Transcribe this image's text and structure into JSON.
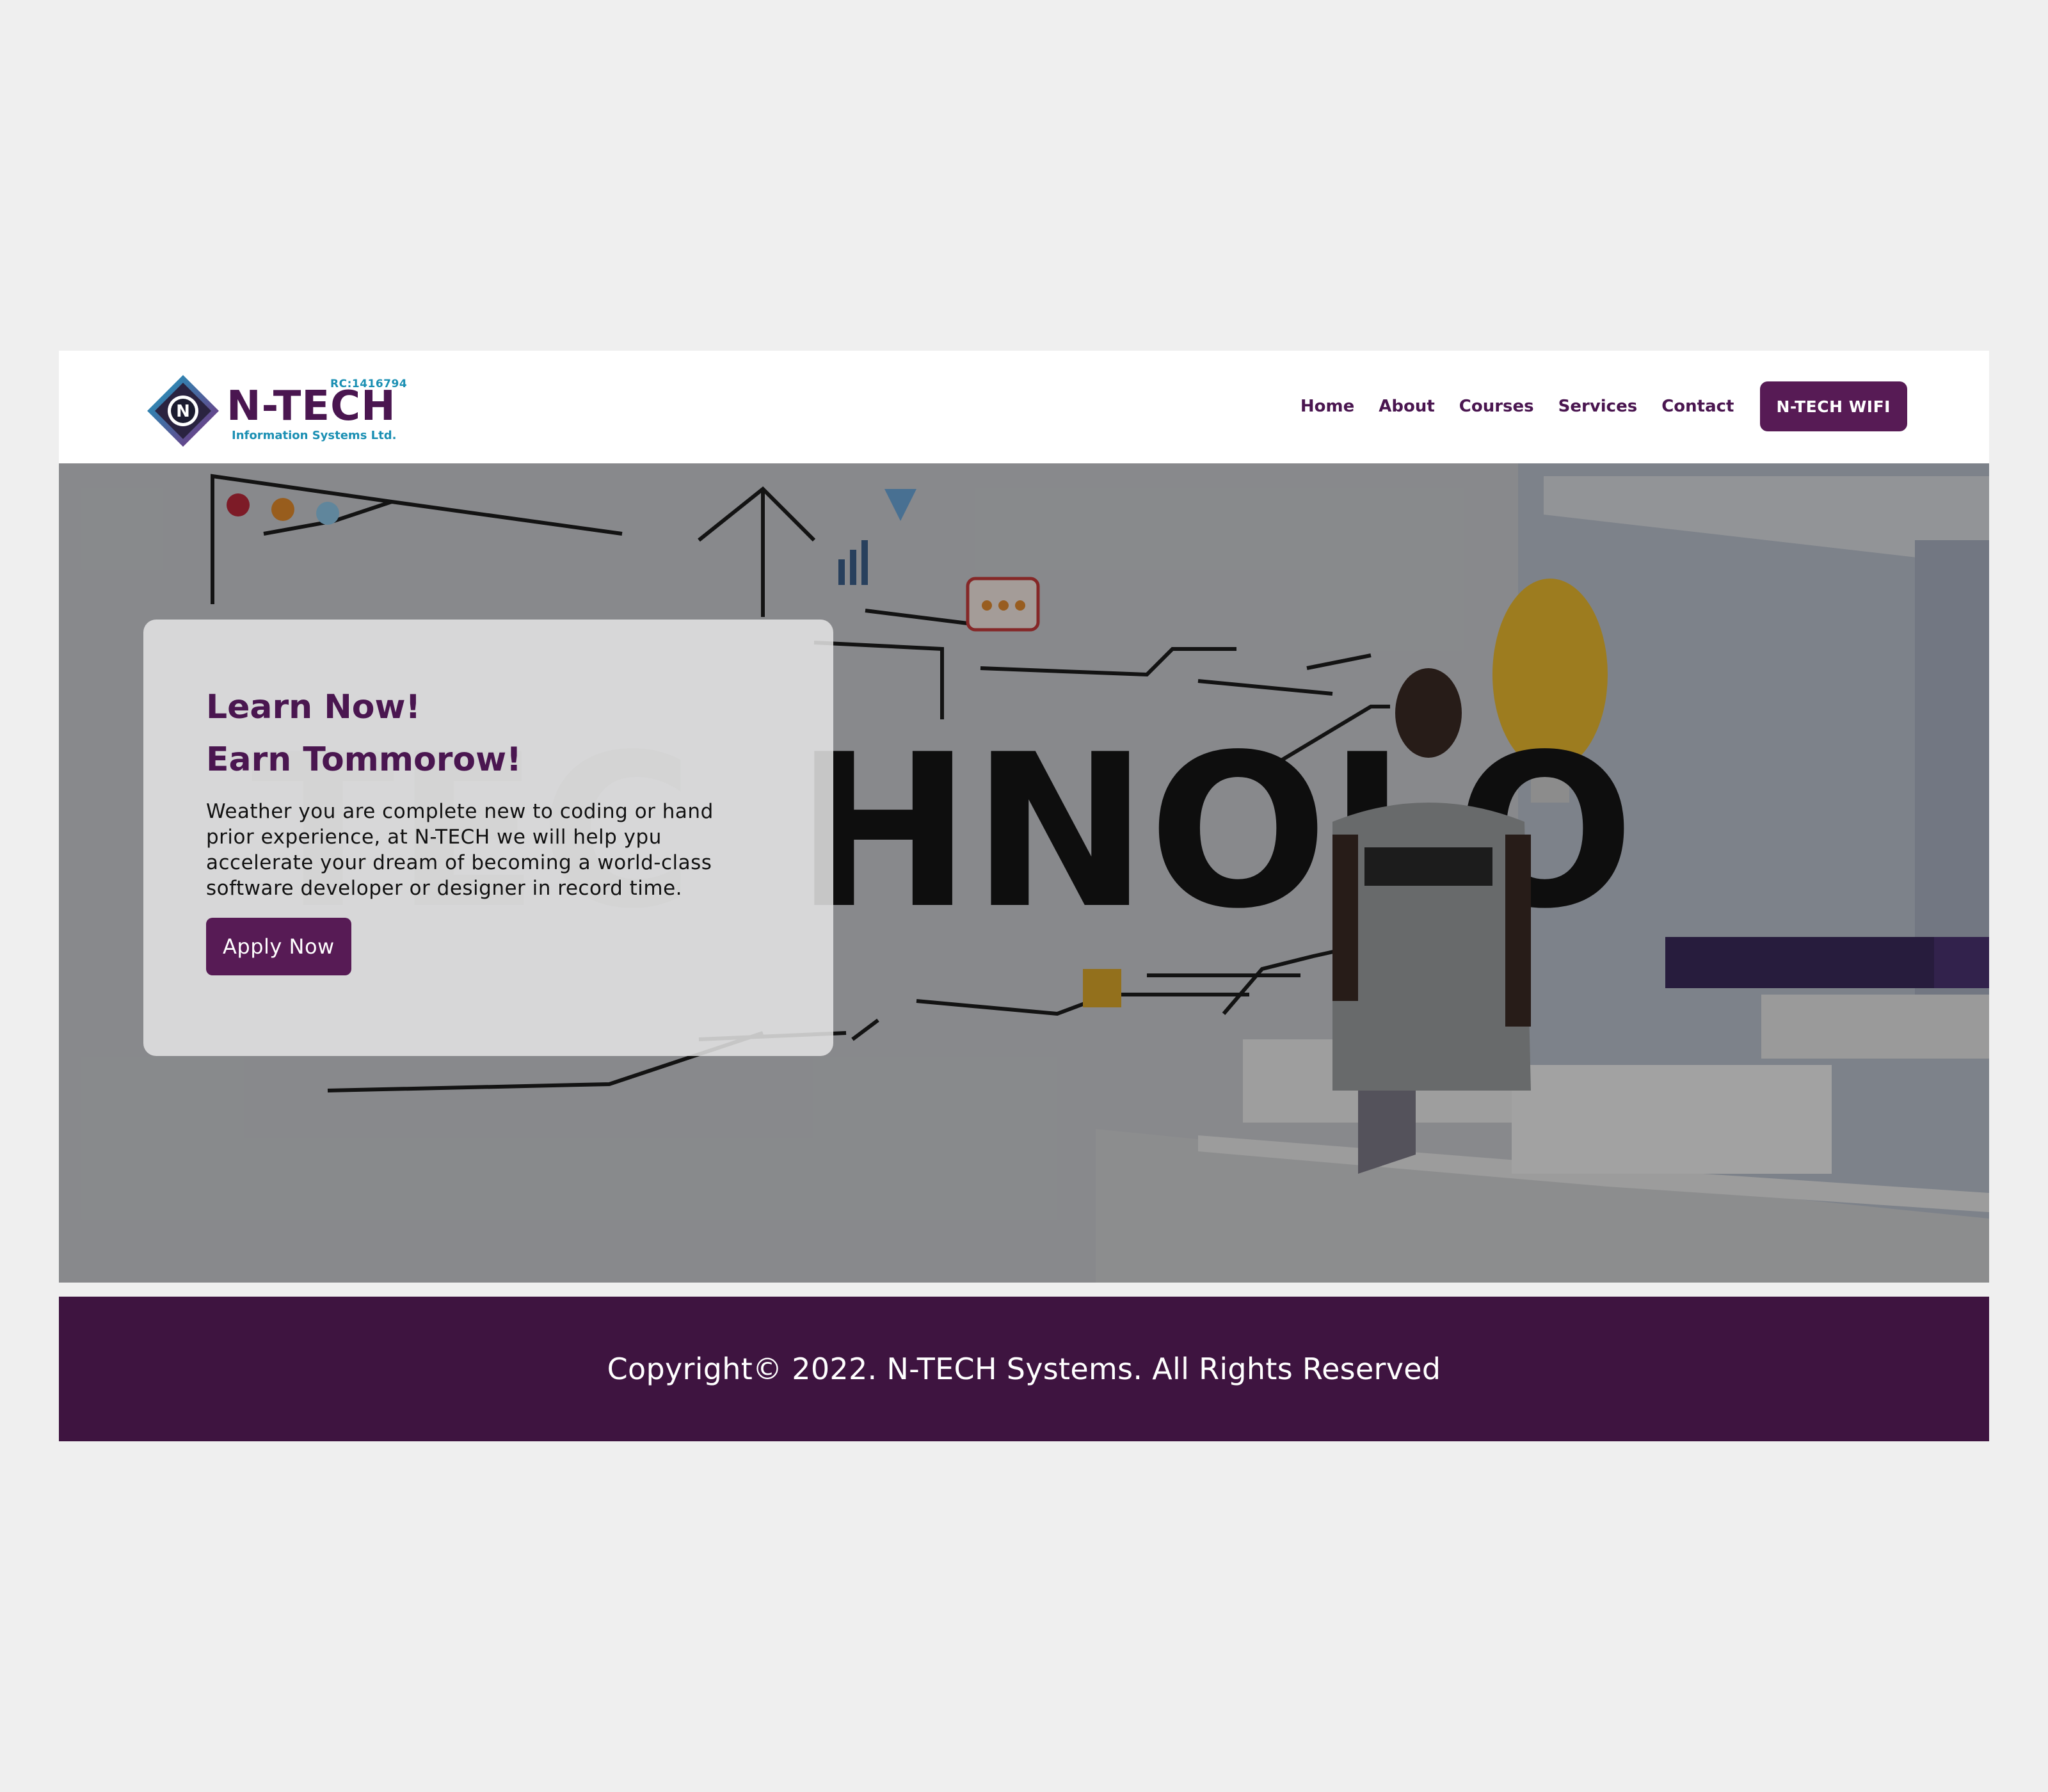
{
  "logo": {
    "rc": "RC:1416794",
    "name": "N-TECH",
    "subtitle": "Information Systems Ltd.",
    "mark_letter": "N"
  },
  "nav": {
    "links": [
      "Home",
      "About",
      "Courses",
      "Services",
      "Contact"
    ],
    "cta_label": "N-TECH WIFI"
  },
  "hero": {
    "title_line1": "Learn Now!",
    "title_line2": "Earn Tommorow!",
    "body": "Weather you are complete new to coding or hand prior experience, at N-TECH we will help ypu accelerate your dream of becoming a world-class software developer or designer in record time.",
    "button_label": "Apply Now",
    "background_image": "office-wall-mural-photo"
  },
  "footer": {
    "copyright": "Copyright© 2022. N-TECH Systems. All Rights Reserved"
  },
  "colors": {
    "brand_purple": "#571b55",
    "footer_purple": "#3e1440",
    "accent_teal": "#1a8fb3",
    "page_bg": "#efefef"
  }
}
